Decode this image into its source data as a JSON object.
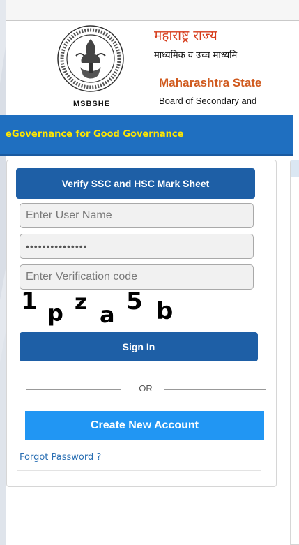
{
  "header": {
    "logo_caption": "MSBSHE",
    "title_marathi": "महाराष्ट्र राज्य",
    "subtitle_marathi": "माध्यमिक व उच्च माध्यमि",
    "title_english": "Maharashtra State",
    "subtitle_english": "Board of Secondary and"
  },
  "nav": {
    "tagline": "eGovernance for Good Governance"
  },
  "login": {
    "verify_tab_label": "Verify SSC and HSC Mark Sheet",
    "username_placeholder": "Enter User Name",
    "password_value": "•••••••••••••••",
    "verification_placeholder": "Enter Verification code",
    "captcha_chars": [
      "1",
      "p",
      "z",
      "a",
      "5",
      "b"
    ],
    "signin_label": "Sign In",
    "or_label": "OR",
    "create_account_label": "Create New Account",
    "forgot_password_label": "Forgot Password ?"
  },
  "colors": {
    "nav_blue": "#1f6fc0",
    "tagline_yellow": "#ffe600",
    "button_blue": "#1e5fa6",
    "create_button_blue": "#2196f3",
    "title_orange": "#d63b1a"
  }
}
